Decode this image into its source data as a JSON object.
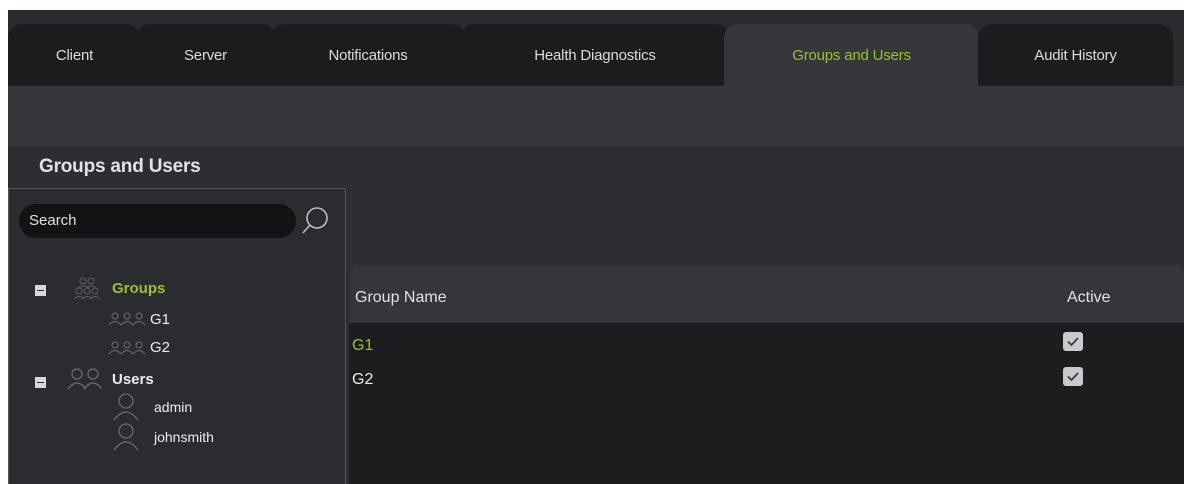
{
  "tabs": [
    {
      "label": "Client",
      "active": false
    },
    {
      "label": "Server",
      "active": false
    },
    {
      "label": "Notifications",
      "active": false
    },
    {
      "label": "Health Diagnostics",
      "active": false
    },
    {
      "label": "Groups and Users",
      "active": true
    },
    {
      "label": "Audit History",
      "active": false
    }
  ],
  "page_title": "Groups and Users",
  "search": {
    "value": "Search"
  },
  "tree": {
    "groups_label": "Groups",
    "groups": [
      "G1",
      "G2"
    ],
    "users_label": "Users",
    "users": [
      "admin",
      "johnsmith"
    ]
  },
  "table": {
    "columns": [
      "Group Name",
      "Active"
    ],
    "rows": [
      {
        "name": "G1",
        "active": true,
        "selected": true
      },
      {
        "name": "G2",
        "active": true,
        "selected": false
      }
    ]
  },
  "colors": {
    "accent": "#9ac41c"
  },
  "icons": {
    "search": "search-icon",
    "collapse": "collapse-icon",
    "group": "group-icon",
    "user": "user-icon",
    "check": "check-icon"
  }
}
